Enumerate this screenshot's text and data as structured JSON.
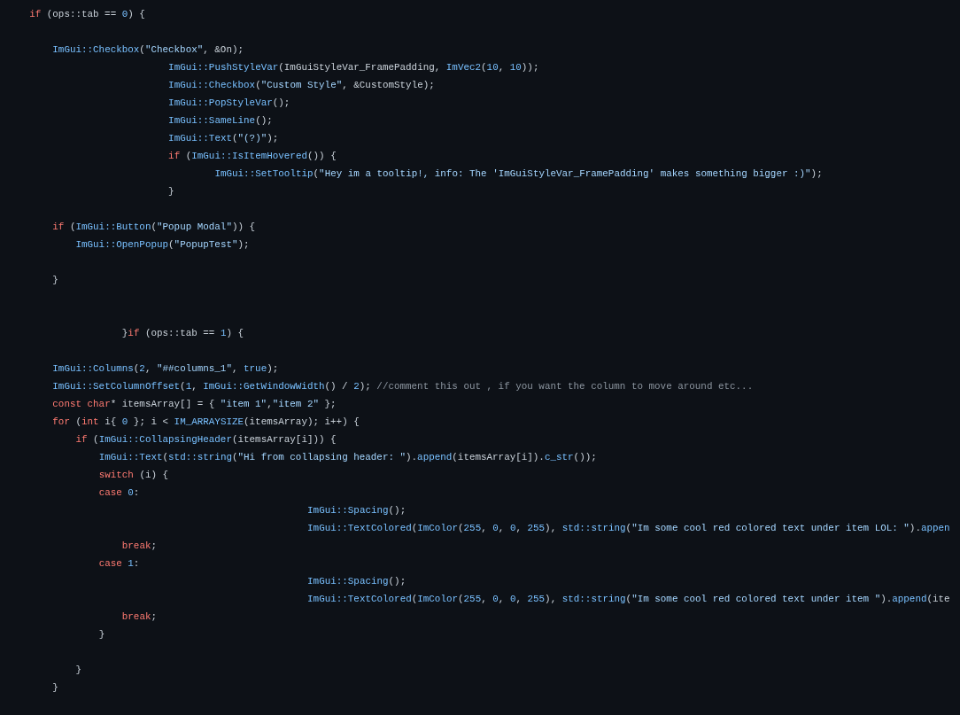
{
  "code_lines": [
    {
      "kind": "one",
      "tokens": [
        {
          "kind": "keyword",
          "text": "if"
        },
        {
          "kind": "plain",
          "text": " (ops::tab == "
        },
        {
          "kind": "number",
          "text": "0"
        },
        {
          "kind": "plain",
          "text": ") {"
        }
      ]
    },
    {
      "kind": "blank"
    },
    {
      "kind": "two",
      "tokens": [
        {
          "kind": "function",
          "text": "ImGui::Checkbox"
        },
        {
          "kind": "plain",
          "text": "("
        },
        {
          "kind": "string",
          "text": "\"Checkbox\""
        },
        {
          "kind": "plain",
          "text": ", &On);"
        }
      ]
    },
    {
      "kind": "seven",
      "tokens": [
        {
          "kind": "function",
          "text": "ImGui::PushStyleVar"
        },
        {
          "kind": "plain",
          "text": "(ImGuiStyleVar_FramePadding, "
        },
        {
          "kind": "function",
          "text": "ImVec2"
        },
        {
          "kind": "plain",
          "text": "("
        },
        {
          "kind": "number",
          "text": "10"
        },
        {
          "kind": "plain",
          "text": ", "
        },
        {
          "kind": "number",
          "text": "10"
        },
        {
          "kind": "plain",
          "text": "));"
        }
      ]
    },
    {
      "kind": "seven",
      "tokens": [
        {
          "kind": "function",
          "text": "ImGui::Checkbox"
        },
        {
          "kind": "plain",
          "text": "("
        },
        {
          "kind": "string",
          "text": "\"Custom Style\""
        },
        {
          "kind": "plain",
          "text": ", &CustomStyle);"
        }
      ]
    },
    {
      "kind": "seven",
      "tokens": [
        {
          "kind": "function",
          "text": "ImGui::PopStyleVar"
        },
        {
          "kind": "plain",
          "text": "();"
        }
      ]
    },
    {
      "kind": "seven",
      "tokens": [
        {
          "kind": "function",
          "text": "ImGui::SameLine"
        },
        {
          "kind": "plain",
          "text": "();"
        }
      ]
    },
    {
      "kind": "seven",
      "tokens": [
        {
          "kind": "function",
          "text": "ImGui::Text"
        },
        {
          "kind": "plain",
          "text": "("
        },
        {
          "kind": "string",
          "text": "\"(?)\""
        },
        {
          "kind": "plain",
          "text": ");"
        }
      ]
    },
    {
      "kind": "seven",
      "tokens": [
        {
          "kind": "keyword",
          "text": "if"
        },
        {
          "kind": "plain",
          "text": " ("
        },
        {
          "kind": "function",
          "text": "ImGui::IsItemHovered"
        },
        {
          "kind": "plain",
          "text": "()) {"
        }
      ]
    },
    {
      "kind": "nine",
      "tokens": [
        {
          "kind": "function",
          "text": "ImGui::SetTooltip"
        },
        {
          "kind": "plain",
          "text": "("
        },
        {
          "kind": "string",
          "text": "\"Hey im a tooltip!, info: The 'ImGuiStyleVar_FramePadding' makes something bigger :)\""
        },
        {
          "kind": "plain",
          "text": ");"
        }
      ]
    },
    {
      "kind": "seven",
      "tokens": [
        {
          "kind": "plain",
          "text": "}"
        }
      ]
    },
    {
      "kind": "blank"
    },
    {
      "kind": "two",
      "tokens": [
        {
          "kind": "keyword",
          "text": "if"
        },
        {
          "kind": "plain",
          "text": " ("
        },
        {
          "kind": "function",
          "text": "ImGui::Button"
        },
        {
          "kind": "plain",
          "text": "("
        },
        {
          "kind": "string",
          "text": "\"Popup Modal\""
        },
        {
          "kind": "plain",
          "text": ")) {"
        }
      ]
    },
    {
      "kind": "three",
      "tokens": [
        {
          "kind": "function",
          "text": "ImGui::OpenPopup"
        },
        {
          "kind": "plain",
          "text": "("
        },
        {
          "kind": "string",
          "text": "\"PopupTest\""
        },
        {
          "kind": "plain",
          "text": ");"
        }
      ]
    },
    {
      "kind": "blank"
    },
    {
      "kind": "two",
      "tokens": [
        {
          "kind": "plain",
          "text": "}"
        }
      ]
    },
    {
      "kind": "blank"
    },
    {
      "kind": "blank"
    },
    {
      "kind": "five",
      "tokens": [
        {
          "kind": "plain",
          "text": "}"
        },
        {
          "kind": "keyword",
          "text": "if"
        },
        {
          "kind": "plain",
          "text": " (ops::tab == "
        },
        {
          "kind": "number",
          "text": "1"
        },
        {
          "kind": "plain",
          "text": ") {"
        }
      ]
    },
    {
      "kind": "blank"
    },
    {
      "kind": "two",
      "tokens": [
        {
          "kind": "function",
          "text": "ImGui::Columns"
        },
        {
          "kind": "plain",
          "text": "("
        },
        {
          "kind": "number",
          "text": "2"
        },
        {
          "kind": "plain",
          "text": ", "
        },
        {
          "kind": "string",
          "text": "\"##columns_1\""
        },
        {
          "kind": "plain",
          "text": ", "
        },
        {
          "kind": "number",
          "text": "true"
        },
        {
          "kind": "plain",
          "text": ");"
        }
      ]
    },
    {
      "kind": "two",
      "tokens": [
        {
          "kind": "function",
          "text": "ImGui::SetColumnOffset"
        },
        {
          "kind": "plain",
          "text": "("
        },
        {
          "kind": "number",
          "text": "1"
        },
        {
          "kind": "plain",
          "text": ", "
        },
        {
          "kind": "function",
          "text": "ImGui::GetWindowWidth"
        },
        {
          "kind": "plain",
          "text": "() / "
        },
        {
          "kind": "number",
          "text": "2"
        },
        {
          "kind": "plain",
          "text": "); "
        },
        {
          "kind": "comment",
          "text": "//comment this out , if you want the column to move around etc..."
        }
      ]
    },
    {
      "kind": "two",
      "tokens": [
        {
          "kind": "keyword",
          "text": "const char"
        },
        {
          "kind": "plain",
          "text": "* itemsArray[] = { "
        },
        {
          "kind": "string",
          "text": "\"item 1\""
        },
        {
          "kind": "plain",
          "text": ","
        },
        {
          "kind": "string",
          "text": "\"item 2\""
        },
        {
          "kind": "plain",
          "text": " };"
        }
      ]
    },
    {
      "kind": "two",
      "tokens": [
        {
          "kind": "keyword",
          "text": "for"
        },
        {
          "kind": "plain",
          "text": " ("
        },
        {
          "kind": "keyword",
          "text": "int"
        },
        {
          "kind": "plain",
          "text": " i{ "
        },
        {
          "kind": "number",
          "text": "0"
        },
        {
          "kind": "plain",
          "text": " }; i < "
        },
        {
          "kind": "function",
          "text": "IM_ARRAYSIZE"
        },
        {
          "kind": "plain",
          "text": "(itemsArray); i++) {"
        }
      ]
    },
    {
      "kind": "three",
      "tokens": [
        {
          "kind": "keyword",
          "text": "if"
        },
        {
          "kind": "plain",
          "text": " ("
        },
        {
          "kind": "function",
          "text": "ImGui::CollapsingHeader"
        },
        {
          "kind": "plain",
          "text": "(itemsArray[i])) {"
        }
      ]
    },
    {
      "kind": "four",
      "tokens": [
        {
          "kind": "function",
          "text": "ImGui::Text"
        },
        {
          "kind": "plain",
          "text": "("
        },
        {
          "kind": "function",
          "text": "std::string"
        },
        {
          "kind": "plain",
          "text": "("
        },
        {
          "kind": "string",
          "text": "\"Hi from collapsing header: \""
        },
        {
          "kind": "plain",
          "text": ")."
        },
        {
          "kind": "function",
          "text": "append"
        },
        {
          "kind": "plain",
          "text": "(itemsArray[i])."
        },
        {
          "kind": "function",
          "text": "c_str"
        },
        {
          "kind": "plain",
          "text": "());"
        }
      ]
    },
    {
      "kind": "four",
      "tokens": [
        {
          "kind": "keyword",
          "text": "switch"
        },
        {
          "kind": "plain",
          "text": " (i) {"
        }
      ]
    },
    {
      "kind": "four",
      "tokens": [
        {
          "kind": "keyword",
          "text": "case"
        },
        {
          "kind": "number",
          "text": " 0"
        },
        {
          "kind": "plain",
          "text": ":"
        }
      ]
    },
    {
      "kind": "thirteen",
      "tokens": [
        {
          "kind": "function",
          "text": "ImGui::Spacing"
        },
        {
          "kind": "plain",
          "text": "();"
        }
      ]
    },
    {
      "kind": "thirteen",
      "tokens": [
        {
          "kind": "function",
          "text": "ImGui::TextColored"
        },
        {
          "kind": "plain",
          "text": "("
        },
        {
          "kind": "function",
          "text": "ImColor"
        },
        {
          "kind": "plain",
          "text": "("
        },
        {
          "kind": "number",
          "text": "255"
        },
        {
          "kind": "plain",
          "text": ", "
        },
        {
          "kind": "number",
          "text": "0"
        },
        {
          "kind": "plain",
          "text": ", "
        },
        {
          "kind": "number",
          "text": "0"
        },
        {
          "kind": "plain",
          "text": ", "
        },
        {
          "kind": "number",
          "text": "255"
        },
        {
          "kind": "plain",
          "text": "), "
        },
        {
          "kind": "function",
          "text": "std::string"
        },
        {
          "kind": "plain",
          "text": "("
        },
        {
          "kind": "string",
          "text": "\"Im some cool red colored text under item LOL: \""
        },
        {
          "kind": "plain",
          "text": ")."
        },
        {
          "kind": "function",
          "text": "appen"
        }
      ]
    },
    {
      "kind": "five",
      "tokens": [
        {
          "kind": "keyword",
          "text": "break"
        },
        {
          "kind": "plain",
          "text": ";"
        }
      ]
    },
    {
      "kind": "four",
      "tokens": [
        {
          "kind": "keyword",
          "text": "case"
        },
        {
          "kind": "number",
          "text": " 1"
        },
        {
          "kind": "plain",
          "text": ":"
        }
      ]
    },
    {
      "kind": "thirteen",
      "tokens": [
        {
          "kind": "function",
          "text": "ImGui::Spacing"
        },
        {
          "kind": "plain",
          "text": "();"
        }
      ]
    },
    {
      "kind": "thirteen",
      "tokens": [
        {
          "kind": "function",
          "text": "ImGui::TextColored"
        },
        {
          "kind": "plain",
          "text": "("
        },
        {
          "kind": "function",
          "text": "ImColor"
        },
        {
          "kind": "plain",
          "text": "("
        },
        {
          "kind": "number",
          "text": "255"
        },
        {
          "kind": "plain",
          "text": ", "
        },
        {
          "kind": "number",
          "text": "0"
        },
        {
          "kind": "plain",
          "text": ", "
        },
        {
          "kind": "number",
          "text": "0"
        },
        {
          "kind": "plain",
          "text": ", "
        },
        {
          "kind": "number",
          "text": "255"
        },
        {
          "kind": "plain",
          "text": "), "
        },
        {
          "kind": "function",
          "text": "std::string"
        },
        {
          "kind": "plain",
          "text": "("
        },
        {
          "kind": "string",
          "text": "\"Im some cool red colored text under item \""
        },
        {
          "kind": "plain",
          "text": ")."
        },
        {
          "kind": "function",
          "text": "append"
        },
        {
          "kind": "plain",
          "text": "(ite"
        }
      ]
    },
    {
      "kind": "five",
      "tokens": [
        {
          "kind": "keyword",
          "text": "break"
        },
        {
          "kind": "plain",
          "text": ";"
        }
      ]
    },
    {
      "kind": "four",
      "tokens": [
        {
          "kind": "plain",
          "text": "}"
        }
      ]
    },
    {
      "kind": "blank"
    },
    {
      "kind": "three",
      "tokens": [
        {
          "kind": "plain",
          "text": "}"
        }
      ]
    },
    {
      "kind": "two",
      "tokens": [
        {
          "kind": "plain",
          "text": "}"
        }
      ]
    }
  ]
}
